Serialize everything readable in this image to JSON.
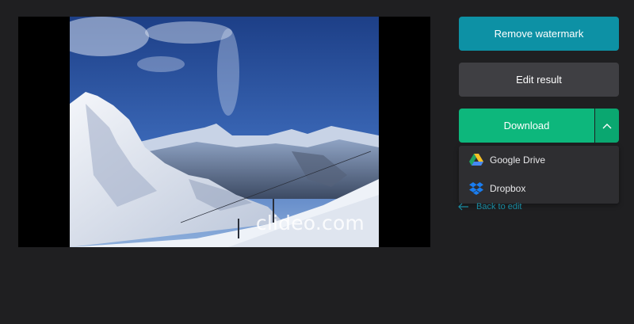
{
  "preview": {
    "watermark_text": "clideo.com"
  },
  "actions": {
    "remove_watermark_label": "Remove watermark",
    "edit_result_label": "Edit result",
    "download_label": "Download"
  },
  "download_menu": {
    "items": [
      {
        "label": "Google Drive",
        "icon": "google-drive-icon"
      },
      {
        "label": "Dropbox",
        "icon": "dropbox-icon"
      }
    ]
  },
  "back_link": {
    "label": "Back to edit",
    "icon": "arrow-left-icon"
  },
  "colors": {
    "background": "#1f1f21",
    "remove_button": "#0d91a5",
    "edit_button": "#3f3f43",
    "download_button": "#0db77c",
    "link": "#1a8aa0"
  }
}
